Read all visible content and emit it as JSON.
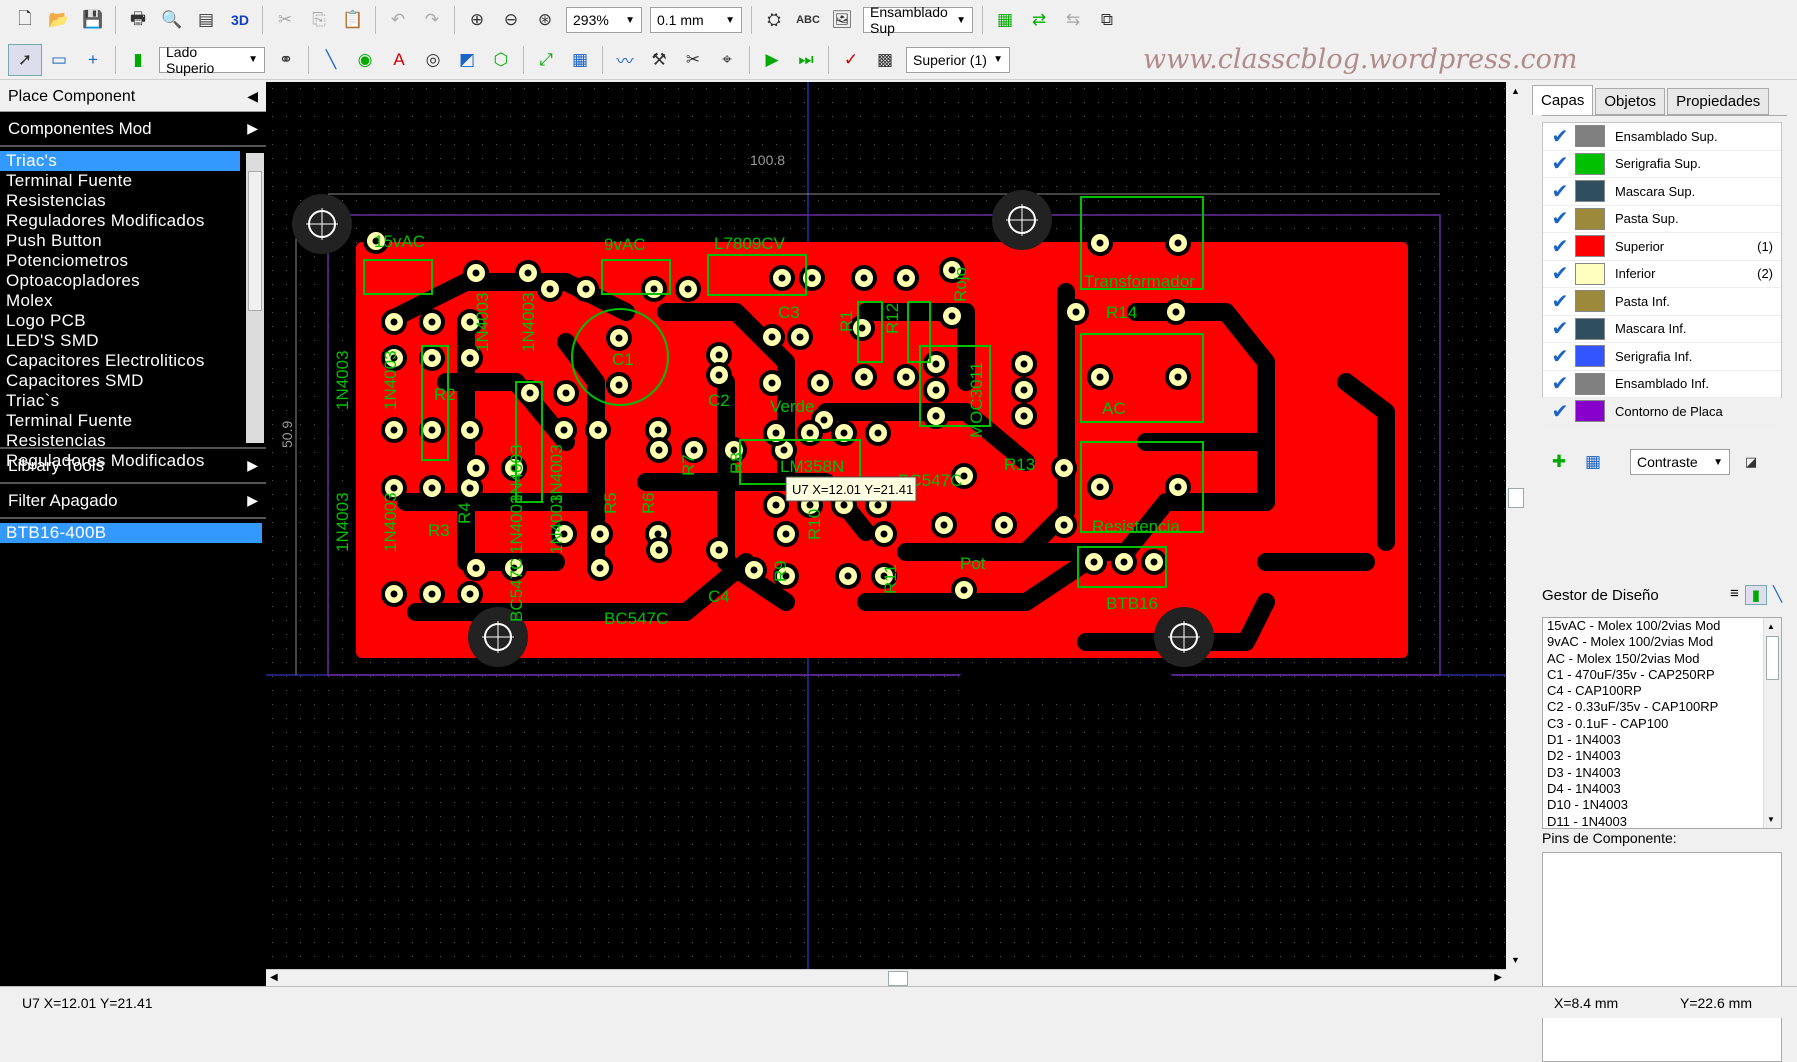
{
  "toolbar1": {
    "zoom": "293%",
    "grid": "0.1 mm",
    "layer_view": "Ensamblado Sup",
    "abc_label": "ABC",
    "three_d_label": "3D"
  },
  "toolbar2": {
    "side": "Lado Superio",
    "layer": "Superior (1)"
  },
  "watermark": "www.classcblog.wordpress.com",
  "left_panel": {
    "place_component": "Place Component",
    "componentes_mod": "Componentes Mod",
    "library_items": [
      "Triac's",
      "Terminal Fuente",
      "Resistencias",
      "Reguladores Modificados",
      "Push Button",
      "Potenciometros",
      "Optoacopladores",
      "Molex",
      "Logo PCB",
      "LED'S SMD",
      "Capacitores Electroliticos",
      "Capacitores SMD",
      "Triac`s",
      "Terminal Fuente",
      "Resistencias",
      "Reguladores Modificados"
    ],
    "library_tools": "Library Tools",
    "filter": "Filter Apagado",
    "filter_item": "BTB16-400B"
  },
  "canvas": {
    "dim_h": "100.8",
    "dim_v": "50.9",
    "tooltip": "U7  X=12.01   Y=21.41",
    "labels": [
      "15vAC",
      "9vAC",
      "L7809CV",
      "C3",
      "C1",
      "C2",
      "R1",
      "R12",
      "R13",
      "R14",
      "R2",
      "R3",
      "R4",
      "R5",
      "R6",
      "R7",
      "R8",
      "R9",
      "R10",
      "R11",
      "Verde",
      "Rojo",
      "LM358N",
      "BC547C",
      "BC547C",
      "BC547C",
      "C4",
      "Pot",
      "Transformador",
      "AC",
      "Resistencia",
      "BTB16",
      "MOC3011",
      "1N4003",
      "1N4003",
      "1N4003",
      "1N4003",
      "1N4003",
      "1N4003",
      "1N4003",
      "1N4003",
      "1N4003",
      "1N4003"
    ]
  },
  "right_panel": {
    "tabs": [
      "Capas",
      "Objetos",
      "Propiedades"
    ],
    "layers": [
      {
        "name": "Ensamblado Sup.",
        "color": "#808080",
        "num": ""
      },
      {
        "name": "Serigrafia Sup.",
        "color": "#00c000",
        "num": ""
      },
      {
        "name": "Mascara Sup.",
        "color": "#2f4f5f",
        "num": ""
      },
      {
        "name": "Pasta Sup.",
        "color": "#9c8a3a",
        "num": ""
      },
      {
        "name": "Superior",
        "color": "#ff0000",
        "num": "(1)"
      },
      {
        "name": "Inferior",
        "color": "#ffffc0",
        "num": "(2)"
      },
      {
        "name": "Pasta Inf.",
        "color": "#9c8a3a",
        "num": ""
      },
      {
        "name": "Mascara Inf.",
        "color": "#2f4f5f",
        "num": ""
      },
      {
        "name": "Serigrafia Inf.",
        "color": "#3355ff",
        "num": ""
      },
      {
        "name": "Ensamblado Inf.",
        "color": "#808080",
        "num": ""
      },
      {
        "name": "Contorno de Placa",
        "color": "#8800cc",
        "num": ""
      }
    ],
    "contrast": "Contraste",
    "design_manager": "Gestor de Diseño",
    "design_items": [
      "15vAC - Molex 100/2vias Mod",
      "9vAC - Molex 100/2vias Mod",
      "AC - Molex 150/2vias Mod",
      "C1 - 470uF/35v - CAP250RP",
      "C4 - CAP100RP",
      "C2 - 0.33uF/35v - CAP100RP",
      "C3 - 0.1uF - CAP100",
      "D1 - 1N4003",
      "D2 - 1N4003",
      "D3 - 1N4003",
      "D4 - 1N4003",
      "D10 - 1N4003",
      "D11 - 1N4003"
    ],
    "pins_label": "Pins de Componente:"
  },
  "status": {
    "left": "U7  X=12.01   Y=21.41",
    "x": "X=8.4 mm",
    "y": "Y=22.6 mm"
  }
}
